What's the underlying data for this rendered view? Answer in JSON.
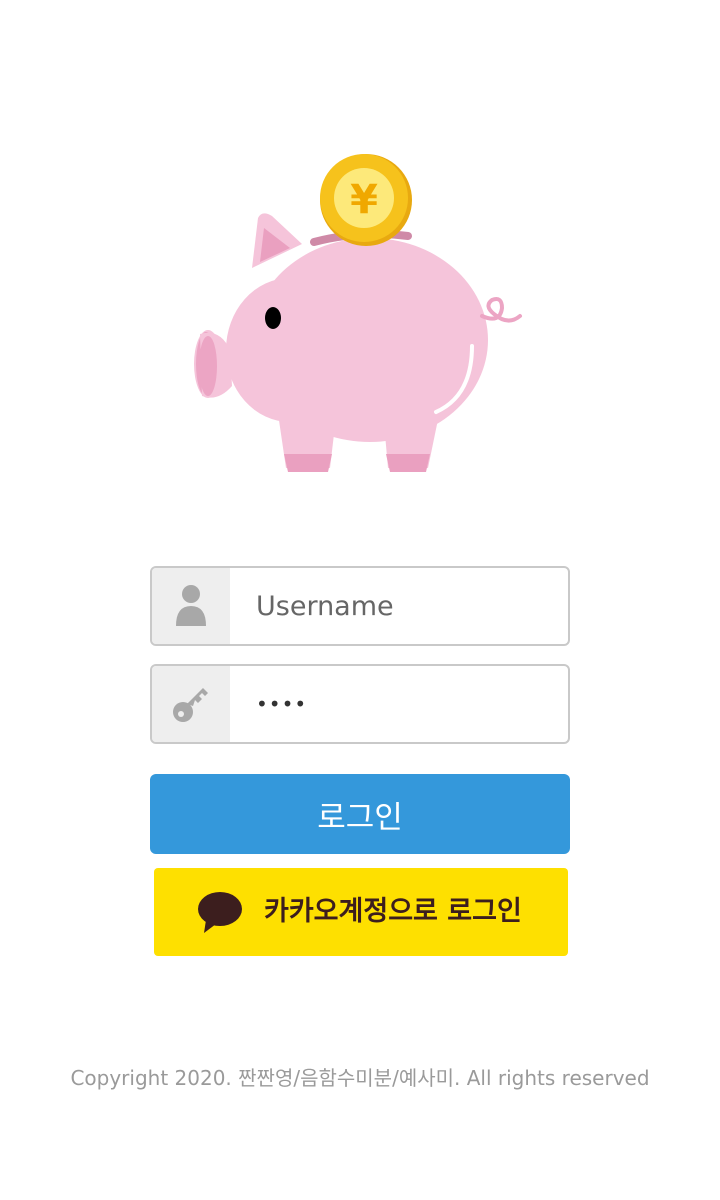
{
  "logo": {
    "description_icon": "piggy-bank-icon",
    "coin_symbol": "¥",
    "colors": {
      "pig": "#f5c4da",
      "pig_dark": "#eaa0c0",
      "coin": "#f6c21c",
      "coin_inner": "#fde97a"
    }
  },
  "login_form": {
    "username": {
      "icon": "user-icon",
      "placeholder": "Username",
      "value": ""
    },
    "password": {
      "icon": "key-icon",
      "placeholder": "",
      "value": "1234"
    },
    "login_button_label": "로그인",
    "kakao_button": {
      "icon": "kakao-speech-bubble-icon",
      "label": "카카오계정으로 로그인"
    }
  },
  "colors": {
    "primary": "#3498db",
    "kakao_yellow": "#fee000",
    "kakao_brown": "#3c1e1e",
    "field_border": "#c9c9c9",
    "icon_bg": "#eeeeee",
    "icon_gray": "#a8a8a8"
  },
  "footer": {
    "copyright": "Copyright 2020. 짠짠영/음함수미분/예사미. All rights reserved"
  }
}
